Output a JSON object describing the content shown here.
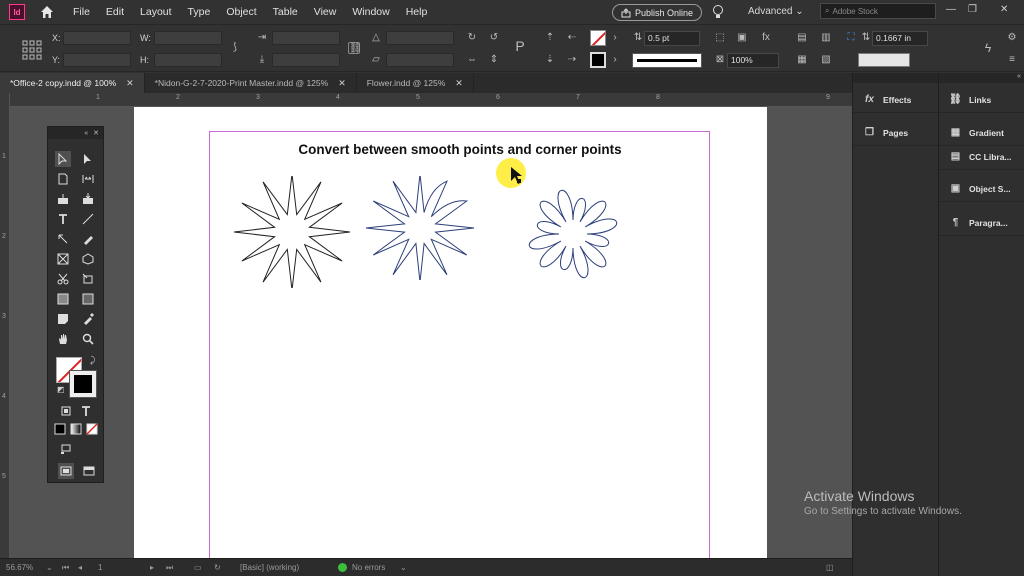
{
  "app": {
    "logo": "Id",
    "icon_home": "home-icon"
  },
  "menu": [
    "File",
    "Edit",
    "Layout",
    "Type",
    "Object",
    "Table",
    "View",
    "Window",
    "Help"
  ],
  "header": {
    "publish_label": "Publish Online",
    "workspace": "Advanced",
    "search_placeholder": "Adobe Stock",
    "window_controls": [
      "—",
      "❐",
      "✕"
    ]
  },
  "control": {
    "x_label": "X:",
    "y_label": "Y:",
    "w_label": "W:",
    "h_label": "H:",
    "stroke_weight": "0.5 pt",
    "opacity": "100%",
    "offset": "0.1667 in"
  },
  "tabs": [
    {
      "label": "*Office-2 copy.indd @ 100%",
      "active": true
    },
    {
      "label": "*Nidon-G-2-7-2020-Print Master.indd @ 125%",
      "active": false
    },
    {
      "label": "Flower.indd @ 125%",
      "active": false
    }
  ],
  "ruler": {
    "h": [
      "1",
      "2",
      "3",
      "4",
      "5",
      "6",
      "7",
      "8",
      "9"
    ],
    "v": [
      "1",
      "2",
      "3",
      "4",
      "5"
    ]
  },
  "document": {
    "title": "Convert between smooth points and corner points"
  },
  "panels": {
    "col1": [
      {
        "label": "Effects",
        "icon": "fx-icon"
      },
      {
        "label": "Pages",
        "icon": "pages-icon"
      }
    ],
    "col2": [
      {
        "label": "Links",
        "icon": "links-icon"
      },
      {
        "label": "Gradient",
        "icon": "gradient-icon"
      },
      {
        "label": "CC Libra...",
        "icon": "cc-libraries-icon"
      },
      {
        "label": "Object S...",
        "icon": "object-styles-icon"
      },
      {
        "label": "Paragra...",
        "icon": "paragraph-styles-icon"
      }
    ]
  },
  "status": {
    "zoom": "56.67%",
    "page": "1",
    "style": "[Basic] (working)",
    "errors": "No errors",
    "error_color": "#3cc03c"
  },
  "watermark": {
    "line1": "Activate Windows",
    "line2": "Go to Settings to activate Windows."
  }
}
